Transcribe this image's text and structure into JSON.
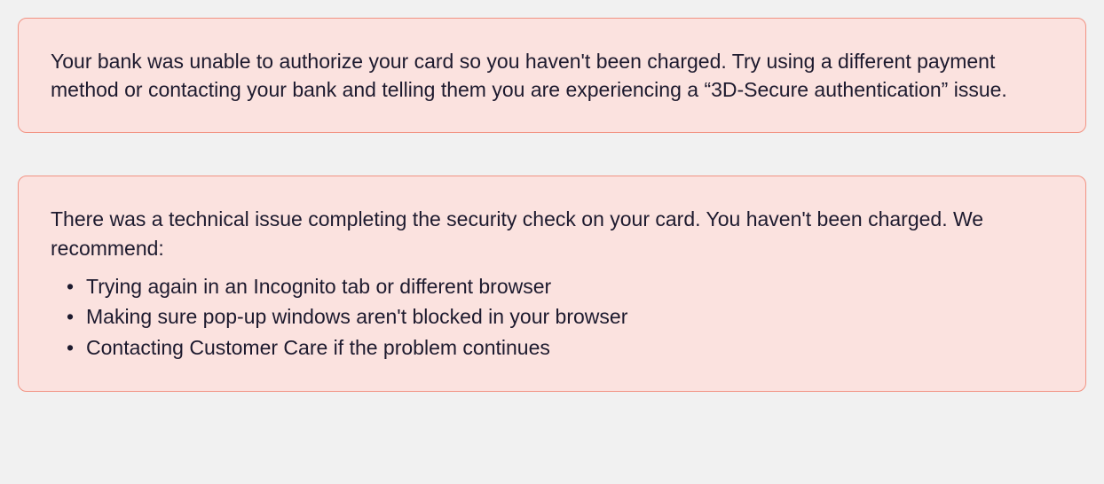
{
  "alerts": [
    {
      "message": "Your bank was unable to authorize your card so you haven't been charged. Try using a different payment method or contacting your bank and telling them you are experiencing a “3D-Secure authentication” issue."
    },
    {
      "message": "There was a technical issue completing the security check on your card. You haven't been charged. We recommend:",
      "bullets": [
        "Trying again in an Incognito tab or different browser",
        "Making sure pop-up windows aren't blocked in your browser",
        "Contacting Customer Care if the problem continues"
      ]
    }
  ]
}
